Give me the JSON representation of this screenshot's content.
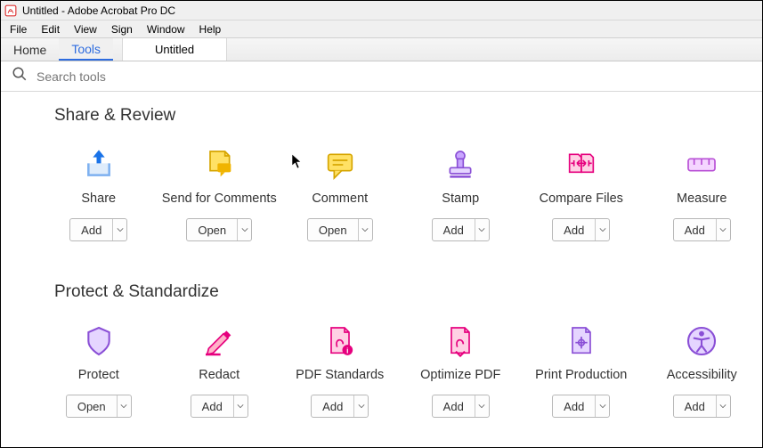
{
  "window": {
    "title": "Untitled - Adobe Acrobat Pro DC"
  },
  "menu": {
    "file": "File",
    "edit": "Edit",
    "view": "View",
    "sign": "Sign",
    "window": "Window",
    "help": "Help"
  },
  "tabs": {
    "home": "Home",
    "tools": "Tools",
    "doc": "Untitled"
  },
  "search": {
    "placeholder": "Search tools"
  },
  "section1": {
    "title": "Share & Review",
    "items": [
      {
        "label": "Share",
        "action": "Add"
      },
      {
        "label": "Send for Comments",
        "action": "Open"
      },
      {
        "label": "Comment",
        "action": "Open"
      },
      {
        "label": "Stamp",
        "action": "Add"
      },
      {
        "label": "Compare Files",
        "action": "Add"
      },
      {
        "label": "Measure",
        "action": "Add"
      }
    ]
  },
  "section2": {
    "title": "Protect & Standardize",
    "items": [
      {
        "label": "Protect",
        "action": "Open"
      },
      {
        "label": "Redact",
        "action": "Add"
      },
      {
        "label": "PDF Standards",
        "action": "Add"
      },
      {
        "label": "Optimize PDF",
        "action": "Add"
      },
      {
        "label": "Print Production",
        "action": "Add"
      },
      {
        "label": "Accessibility",
        "action": "Add"
      }
    ]
  }
}
